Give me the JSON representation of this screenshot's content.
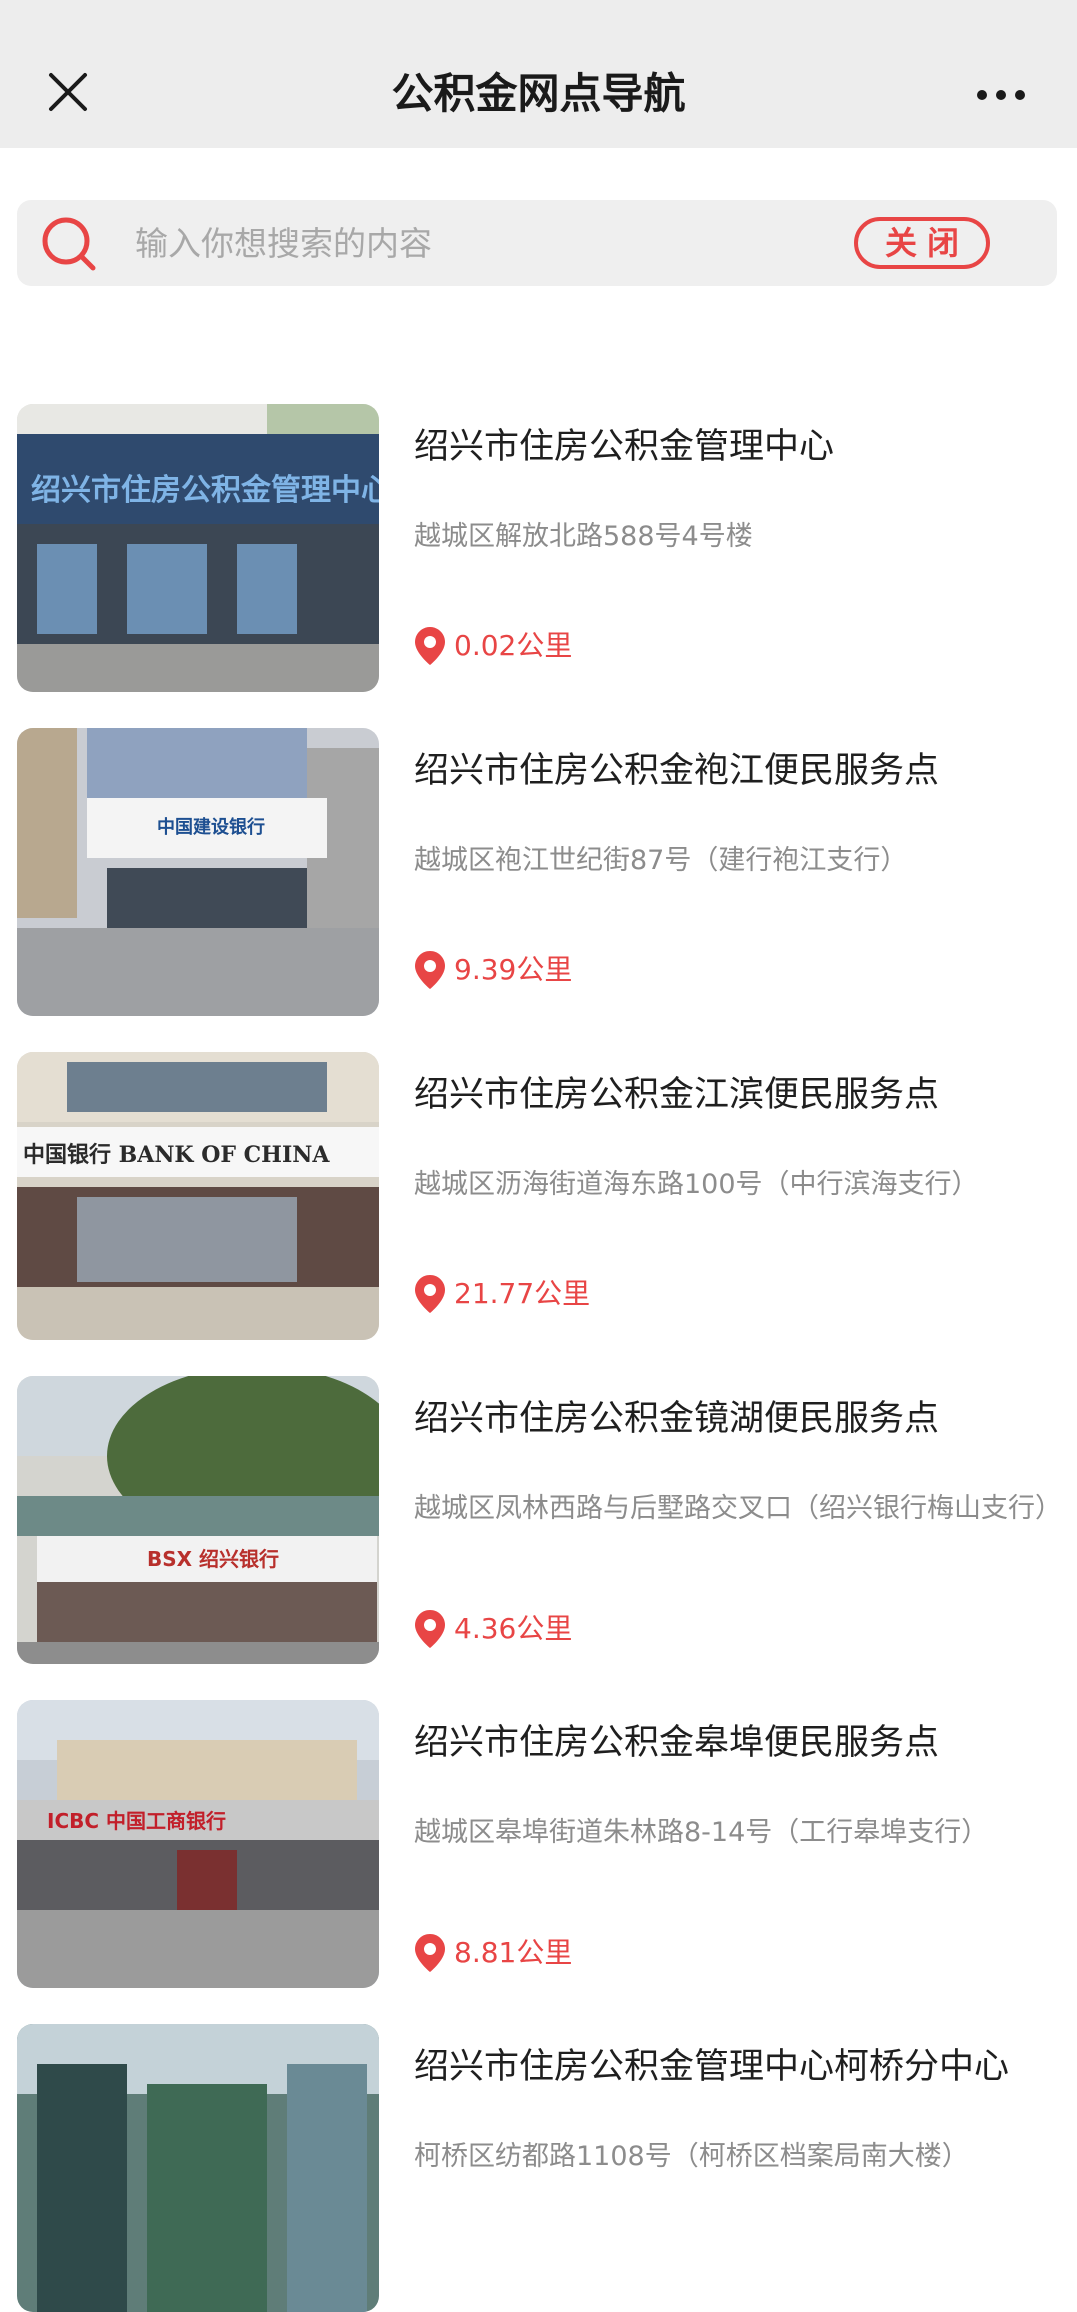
{
  "header": {
    "title": "公积金网点导航",
    "close_icon": "close-icon",
    "more_icon": "more-dots-icon"
  },
  "search": {
    "placeholder": "输入你想搜索的内容",
    "value": "",
    "close_label": "关闭",
    "icon": "search-icon"
  },
  "colors": {
    "accent": "#e84545",
    "header_bg": "#ededed",
    "search_bg": "#efefef"
  },
  "items": [
    {
      "name": "绍兴市住房公积金管理中心",
      "address": "越城区解放北路588号4号楼",
      "distance": "0.02公里",
      "photo_sign": "绍兴市住房公积金管理中心"
    },
    {
      "name": "绍兴市住房公积金袍江便民服务点",
      "address": "越城区袍江世纪街87号（建行袍江支行）",
      "distance": "9.39公里",
      "photo_sign": "中国建设银行"
    },
    {
      "name": "绍兴市住房公积金江滨便民服务点",
      "address": "越城区沥海街道海东路100号（中行滨海支行）",
      "distance": "21.77公里",
      "photo_sign": "中国银行 BANK OF CHINA"
    },
    {
      "name": "绍兴市住房公积金镜湖便民服务点",
      "address": "越城区凤林西路与后墅路交叉口（绍兴银行梅山支行）",
      "distance": "4.36公里",
      "photo_sign": "BSX 绍兴银行"
    },
    {
      "name": "绍兴市住房公积金皋埠便民服务点",
      "address": "越城区皋埠街道朱林路8-14号（工行皋埠支行）",
      "distance": "8.81公里",
      "photo_sign": "ICBC 中国工商银行"
    },
    {
      "name": "绍兴市住房公积金管理中心柯桥分中心",
      "address": "柯桥区纺都路1108号（柯桥区档案局南大楼）",
      "distance": "",
      "photo_sign": ""
    }
  ]
}
